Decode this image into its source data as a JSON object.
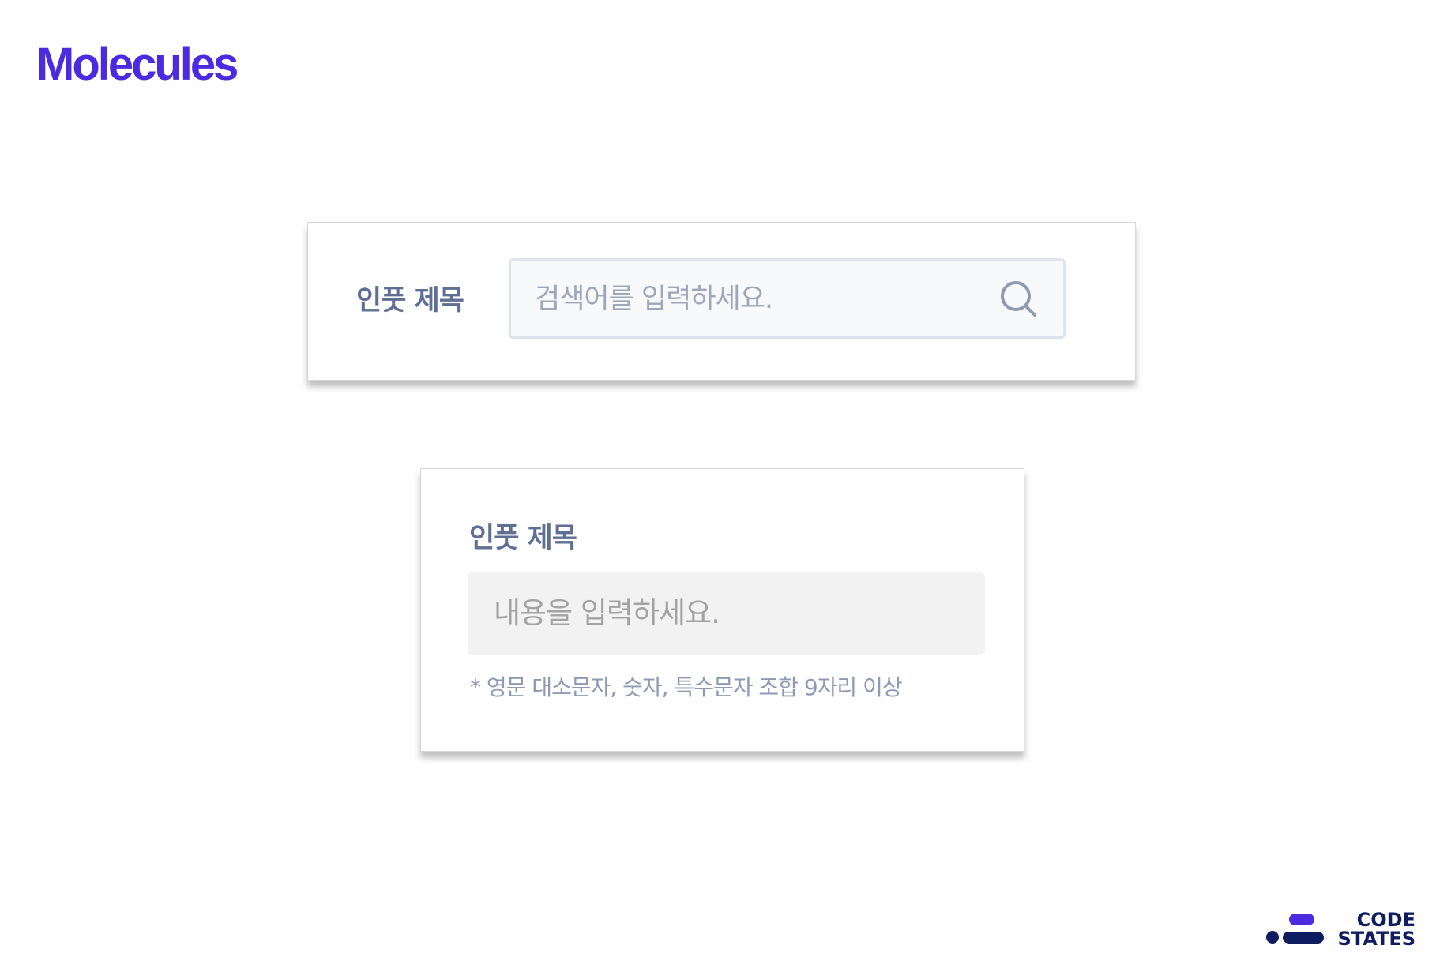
{
  "page": {
    "title": "Molecules"
  },
  "search_molecule": {
    "label": "인풋 제목",
    "input_placeholder": "검색어를 입력하세요.",
    "icon": "search-icon"
  },
  "content_molecule": {
    "label": "인풋 제목",
    "input_placeholder": "내용을 입력하세요.",
    "helper_text": "* 영문 대소문자, 숫자, 특수문자 조합 9자리 이상"
  },
  "logo": {
    "line1": "CODE",
    "line2": "STATES",
    "brand_color": "#0e1d5f",
    "accent_color": "#4a2be0"
  },
  "colors": {
    "title": "#4a2be0",
    "label": "#5f6f94",
    "placeholder": "#9ea7b9",
    "helper": "#8e9ab3"
  }
}
